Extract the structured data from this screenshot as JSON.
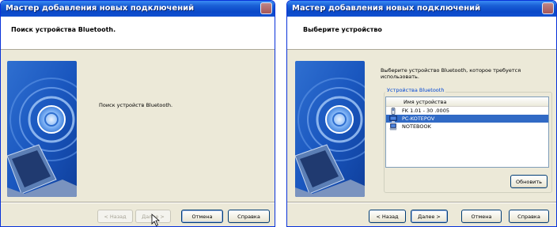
{
  "colors": {
    "title_bar": "#0a48c8",
    "window_bg": "#ece9d8",
    "selection": "#316ac5",
    "group_label": "#0046d5"
  },
  "left_window": {
    "title": "Мастер добавления новых подключений",
    "header_title": "Поиск устройства Bluetooth.",
    "status_text": "Поиск устройств Bluetooth.",
    "buttons": {
      "back": "< Назад",
      "next": "Далее >",
      "cancel": "Отмена",
      "help": "Справка"
    },
    "icons": [
      "bluetooth-wizard-art",
      "mouse-cursor-icon"
    ]
  },
  "right_window": {
    "title": "Мастер добавления новых подключений",
    "header_title": "Выберите устройство",
    "instruction": "Выберите устройство Bluetooth, которое требуется использовать.",
    "group_label": "Устройства Bluetooth",
    "list_header": "Имя устройства",
    "devices": [
      {
        "name": "FK 1.01 - 30 .0005",
        "icon": "phone-icon",
        "selected": false
      },
      {
        "name": "PC-KOTEPOV",
        "icon": "computer-icon",
        "selected": true
      },
      {
        "name": "NOTEBOOK",
        "icon": "laptop-icon",
        "selected": false
      }
    ],
    "refresh_button": "Обновить",
    "buttons": {
      "back": "< Назад",
      "next": "Далее >",
      "cancel": "Отмена",
      "help": "Справка"
    }
  }
}
